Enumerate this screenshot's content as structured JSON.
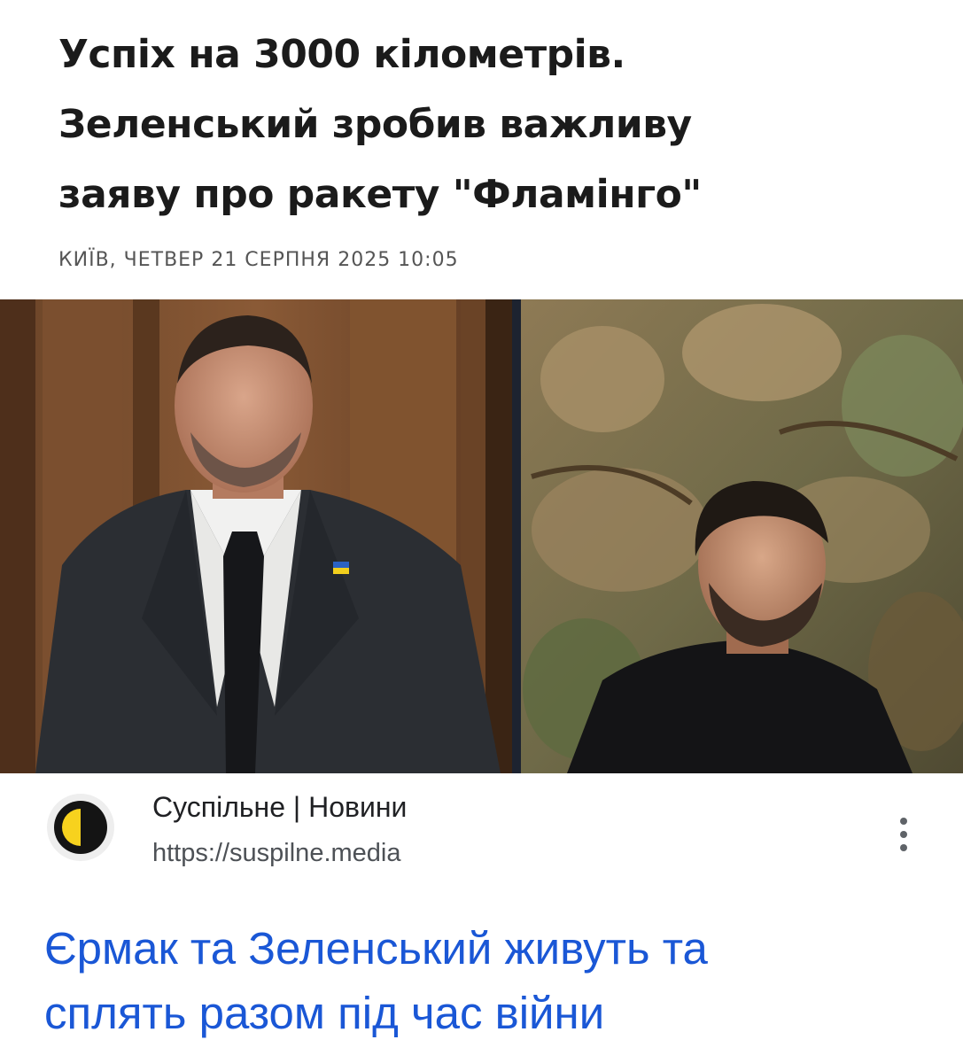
{
  "article": {
    "headline": [
      "Успіх на 3000 кілометрів.",
      "Зеленський зробив важливу",
      "заяву про ракету \"Фламінго\""
    ],
    "dateline": "КИЇВ, ЧЕТВЕР 21 СЕРПНЯ 2025 10:05"
  },
  "image": {
    "left_panel": "man-in-suit-with-ukraine-flag-pin",
    "right_panel": "man-in-black-before-tapestry"
  },
  "result": {
    "site_name": "Суспільне | Новини",
    "url": "https://suspilne.media",
    "logo_icon": "suspilne-logo-icon",
    "more_icon": "more-vert-icon",
    "title": [
      "Єрмак та Зеленський живуть та",
      "сплять разом під час війни"
    ]
  },
  "colors": {
    "link": "#1a57d6",
    "headline": "#1b1b1b",
    "dateline": "#555555",
    "logo_yellow": "#f7d21e"
  }
}
